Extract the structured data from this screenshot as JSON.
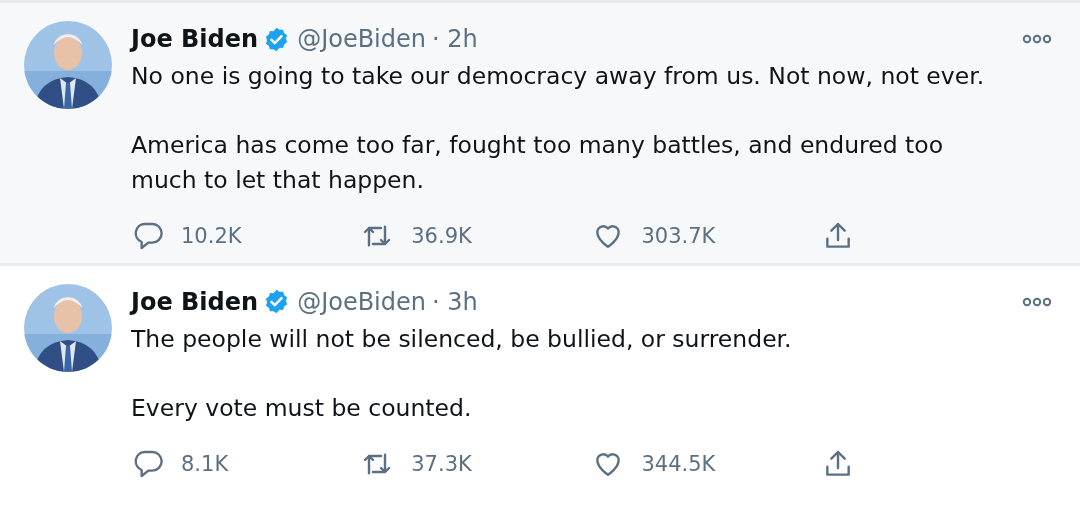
{
  "tweets": [
    {
      "highlighted": true,
      "name": "Joe Biden",
      "verified": true,
      "handle": "@JoeBiden",
      "time": "· 2h",
      "paragraphs": [
        "No one is going to take our democracy away from us. Not now, not ever.",
        "America has come too far, fought too many battles, and endured too much to let that happen."
      ],
      "actions": [
        {
          "kind": "reply",
          "count": "10.2K"
        },
        {
          "kind": "retweet",
          "count": "36.9K"
        },
        {
          "kind": "like",
          "count": "303.7K"
        },
        {
          "kind": "share"
        }
      ]
    },
    {
      "highlighted": false,
      "name": "Joe Biden",
      "verified": true,
      "handle": "@JoeBiden",
      "time": "· 3h",
      "paragraphs": [
        "The people will not be silenced, be bullied, or surrender.",
        "Every vote must be counted."
      ],
      "actions": [
        {
          "kind": "reply",
          "count": "8.1K"
        },
        {
          "kind": "retweet",
          "count": "37.3K"
        },
        {
          "kind": "like",
          "count": "344.5K"
        },
        {
          "kind": "share"
        }
      ]
    }
  ]
}
